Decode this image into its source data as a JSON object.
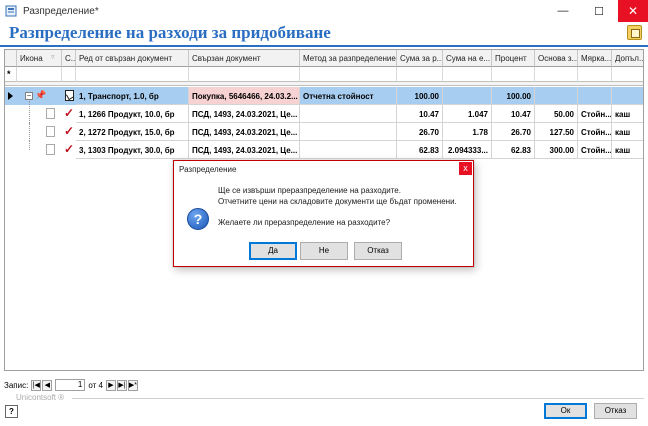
{
  "window": {
    "title": "Разпределение*",
    "header_title": "Разпределение на разходи за придобиване"
  },
  "grid": {
    "columns": [
      "Икона",
      "С...",
      "Ред от свързан документ",
      "Свързан документ",
      "Метод за разпределение",
      "Сума за р...",
      "Сума на е...",
      "Процент",
      "Основа з...",
      "Мярка...",
      "Допъл..."
    ],
    "filter_row_marker": "*",
    "rows": [
      {
        "line": "1, Транспорт, 1.0, бр",
        "doc": "Покупка, 5646466, 24.03.2...",
        "method": "Отчетна стойност",
        "amount": "100.00",
        "amount2": "",
        "percent": "100.00",
        "base": "",
        "unit": ""
      },
      {
        "line": "1, 1266 Продукт, 10.0, бр",
        "doc": "ПСД, 1493, 24.03.2021, Це...",
        "method": "",
        "amount": "10.47",
        "amount2": "1.047",
        "percent": "10.47",
        "base": "50.00",
        "unit": "Стойн...",
        "extra": "каш"
      },
      {
        "line": "2, 1272 Продукт, 15.0, бр",
        "doc": "ПСД, 1493, 24.03.2021, Це...",
        "method": "",
        "amount": "26.70",
        "amount2": "1.78",
        "percent": "26.70",
        "base": "127.50",
        "unit": "Стойн...",
        "extra": "каш"
      },
      {
        "line": "3, 1303 Продукт, 30.0, бр",
        "doc": "ПСД, 1493, 24.03.2021, Це...",
        "method": "",
        "amount": "62.83",
        "amount2": "2.094333...",
        "percent": "62.83",
        "base": "300.00",
        "unit": "Стойн...",
        "extra": "каш"
      }
    ]
  },
  "navigator": {
    "label": "Запис:",
    "current": "1",
    "of_label": "от 4",
    "first": "|◀",
    "prev": "◀",
    "next": "▶",
    "last": "▶|",
    "new": "▶*"
  },
  "brand": "Unicontsoft ®",
  "footer": {
    "help": "?",
    "ok_label": "Ок",
    "cancel_label": "Отказ"
  },
  "dialog": {
    "title": "Разпределение",
    "close": "x",
    "line1": "Ще се извърши преразпределение на разходите.",
    "line2": "Отчетните цени на складовите документи ще бъдат променени.",
    "line3": "Желаете ли преразпределение на разходите?",
    "yes_label": "Да",
    "no_label": "Не",
    "cancel_label": "Отказ",
    "icon": "question-icon"
  },
  "colors": {
    "accent": "#2a6ec2",
    "selection": "#a7cdf0",
    "highlight": "#f6d2d2",
    "check": "#c01020"
  }
}
